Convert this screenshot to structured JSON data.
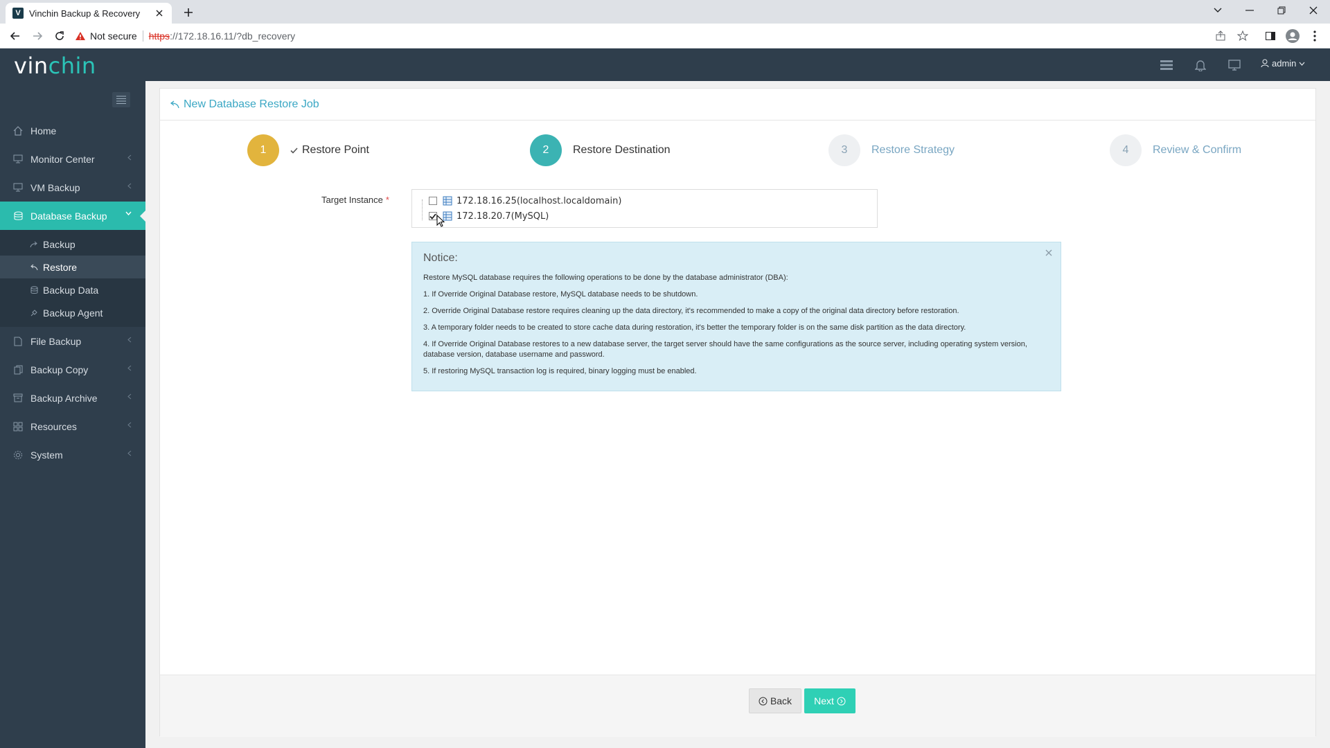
{
  "browser": {
    "tab_title": "Vinchin Backup & Recovery",
    "favicon_letter": "V",
    "not_secure": "Not secure",
    "url_scheme": "https",
    "url_rest": "://172.18.16.11/?db_recovery"
  },
  "header": {
    "logo_part1": "vin",
    "logo_part2": "chin",
    "user": "admin"
  },
  "sidebar": {
    "items": [
      {
        "label": "Home"
      },
      {
        "label": "Monitor Center"
      },
      {
        "label": "VM Backup"
      },
      {
        "label": "Database Backup"
      },
      {
        "label": "File Backup"
      },
      {
        "label": "Backup Copy"
      },
      {
        "label": "Backup Archive"
      },
      {
        "label": "Resources"
      },
      {
        "label": "System"
      }
    ],
    "sub_items": [
      {
        "label": "Backup"
      },
      {
        "label": "Restore"
      },
      {
        "label": "Backup Data"
      },
      {
        "label": "Backup Agent"
      }
    ]
  },
  "page": {
    "title": "New Database Restore Job",
    "steps": [
      {
        "num": "1",
        "label": "Restore Point"
      },
      {
        "num": "2",
        "label": "Restore Destination"
      },
      {
        "num": "3",
        "label": "Restore Strategy"
      },
      {
        "num": "4",
        "label": "Review & Confirm"
      }
    ],
    "target_label": "Target Instance",
    "required_mark": "*",
    "instances": [
      {
        "label": "172.18.16.25(localhost.localdomain)",
        "checked": false
      },
      {
        "label": "172.18.20.7(MySQL)",
        "checked": true
      }
    ],
    "notice": {
      "title": "Notice:",
      "lines": [
        "Restore MySQL database requires the following operations to be done by the database administrator (DBA):",
        "1. If Override Original Database restore, MySQL database needs to be shutdown.",
        "2. Override Original Database restore requires cleaning up the data directory, it's recommended to make a copy of the original data directory before restoration.",
        "3. A temporary folder needs to be created to store cache data during restoration, it's better the temporary folder is on the same disk partition as the data directory.",
        "4. If Override Original Database restores to a new database server, the target server should have the same configurations as the source server, including operating system version, database version, database username and password.",
        "5. If restoring MySQL transaction log is required, binary logging must be enabled."
      ]
    },
    "back_label": "Back",
    "next_label": "Next"
  }
}
